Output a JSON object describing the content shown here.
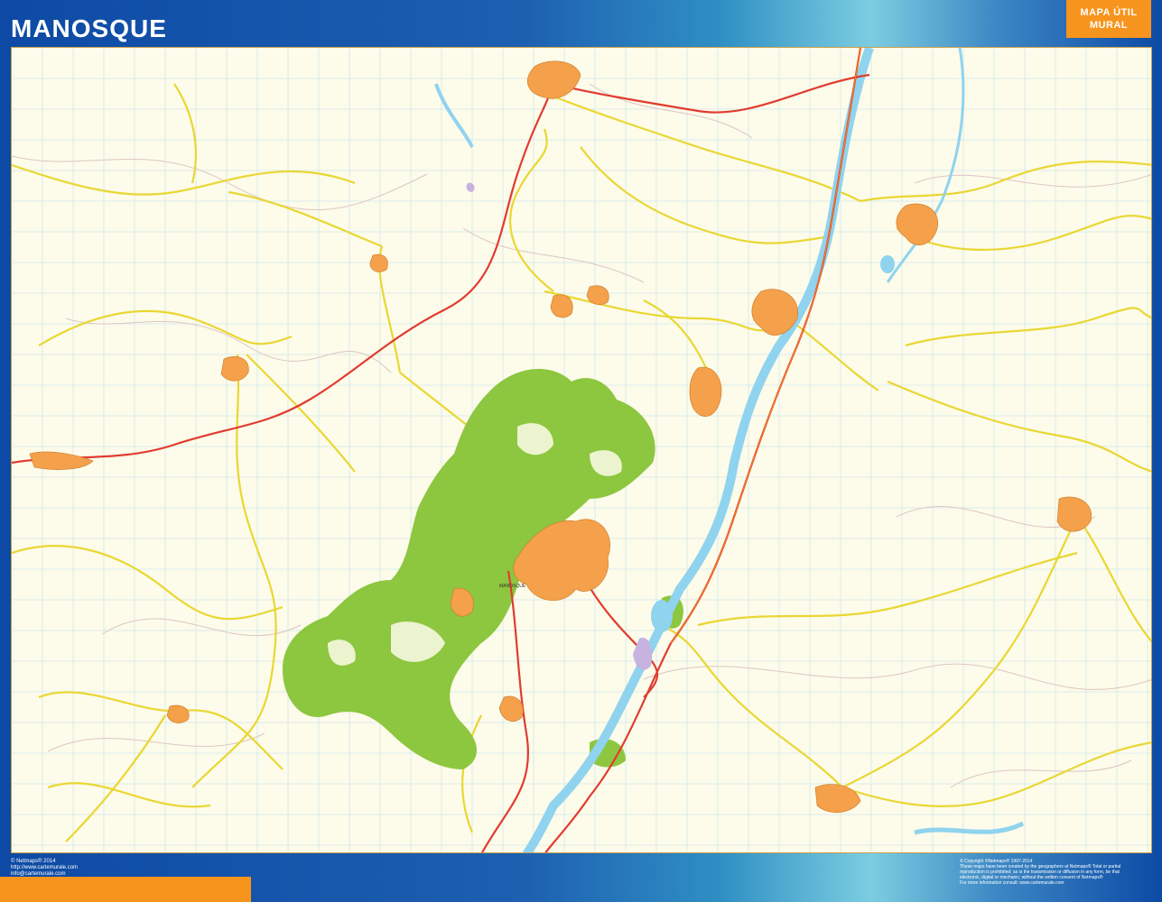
{
  "header": {
    "title": "MANOSQUE",
    "badge_line1": "MAPA ÚTIL",
    "badge_line2": "MURAL"
  },
  "footer": {
    "left": [
      "© Netmaps® 2014",
      "http://www.cartemurale.com",
      "info@cartemurale.com"
    ],
    "right": [
      "© Copyright ©Netmaps® 1997-2014",
      "These maps have been created by the geographers at Netmaps® Total or partial",
      "reproduction is prohibited; as is the transmission or diffusion in any form, be that",
      "electronic, digital or mechanic; without the written consent of Netmaps®",
      "For more information consult: www.cartemurale.com"
    ]
  },
  "map": {
    "place_label": "MANOSQUE",
    "colors": {
      "background": "#fdfbe9",
      "urban": "#f5a04a",
      "forest": "#8dc63f",
      "water": "#8fd3ef",
      "main_road": "#e03c31",
      "secondary_road": "#f2e04a",
      "minor_road": "#d9c2c2",
      "grid": "#cfe9ee"
    }
  }
}
